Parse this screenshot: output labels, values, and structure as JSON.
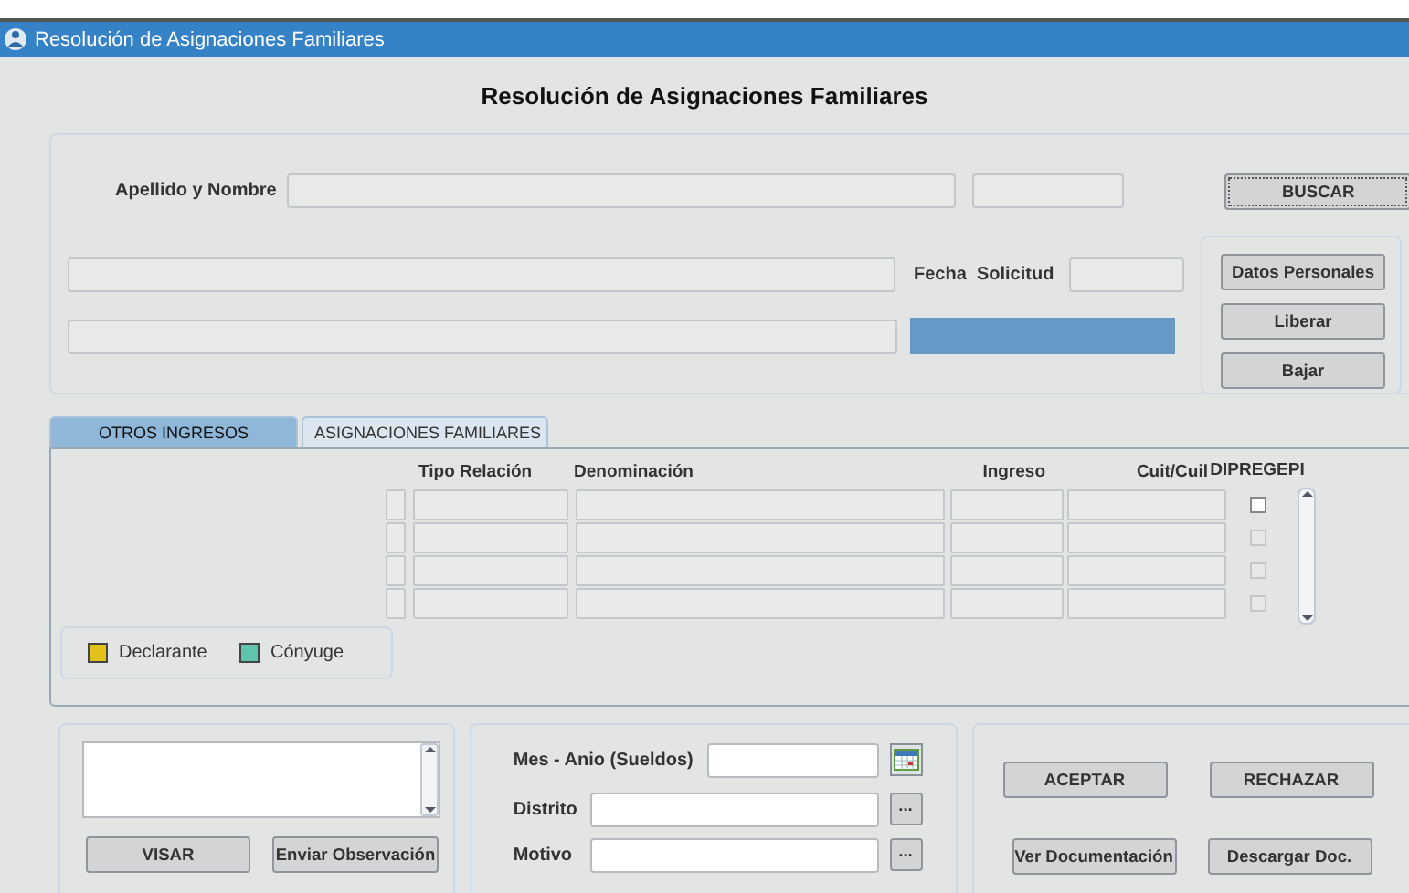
{
  "window": {
    "title": "Resolución de Asignaciones Familiares"
  },
  "heading": "Resolución de Asignaciones Familiares",
  "search": {
    "label": "Apellido y Nombre",
    "button": "BUSCAR",
    "focused": true
  },
  "fecha_solicitud": {
    "label": "Fecha  Solicitud"
  },
  "side_buttons": [
    "Datos Personales",
    "Liberar",
    "Bajar"
  ],
  "tabs": [
    {
      "label": "OTROS INGRESOS",
      "selected": true
    },
    {
      "label": "ASIGNACIONES FAMILIARES",
      "selected": false
    }
  ],
  "table": {
    "columns": [
      "Tipo Relación",
      "Denominación",
      "Ingreso",
      "Cuit/Cuil",
      "DIPREGEPI"
    ],
    "rows": [
      {
        "checked": false,
        "disabled": false
      },
      {
        "checked": false,
        "disabled": true
      },
      {
        "checked": false,
        "disabled": true
      },
      {
        "checked": false,
        "disabled": true
      }
    ]
  },
  "legend": [
    {
      "label": "Declarante",
      "color": "#e2c21a"
    },
    {
      "label": "Cónyuge",
      "color": "#5fc3ad"
    }
  ],
  "observation": {
    "buttons": [
      "VISAR",
      "Enviar Observación"
    ]
  },
  "fields": [
    {
      "label": "Mes - Anio (Sueldos)",
      "kind": "date"
    },
    {
      "label": "Distrito",
      "kind": "lookup",
      "button": "..."
    },
    {
      "label": "Motivo",
      "kind": "lookup",
      "button": "..."
    }
  ],
  "actions": [
    "ACEPTAR",
    "RECHAZAR",
    "Ver Documentación",
    "Descargar Doc."
  ]
}
